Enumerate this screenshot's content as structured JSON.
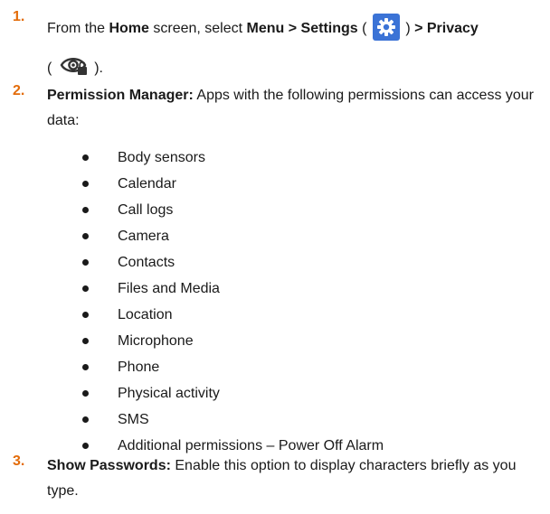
{
  "steps": [
    {
      "number": "1.",
      "parts": {
        "t1": "From the ",
        "b1": "Home",
        "t2": " screen, select ",
        "b2": "Menu > Settings",
        "t3": " ( ",
        "t4": " ) ",
        "b3": "> Privacy",
        "t5": "( ",
        "t6": " )."
      },
      "icons": [
        "gear-icon",
        "eye-lock-icon"
      ]
    },
    {
      "number": "2.",
      "bold": "Permission Manager:",
      "text": " Apps with the following permissions can access your data:"
    },
    {
      "number": "3.",
      "bold": "Show Passwords:",
      "text": " Enable this option to display characters briefly as you type."
    }
  ],
  "permissions": [
    "Body sensors",
    "Calendar",
    "Call logs",
    "Camera",
    "Contacts",
    "Files and Media",
    "Location",
    "Microphone",
    "Phone",
    "Physical activity",
    "SMS",
    "Additional permissions – Power Off Alarm"
  ],
  "colors": {
    "number": "#e36c0a",
    "settings_icon_bg": "#3b73d6",
    "text": "#1a1a1a"
  }
}
